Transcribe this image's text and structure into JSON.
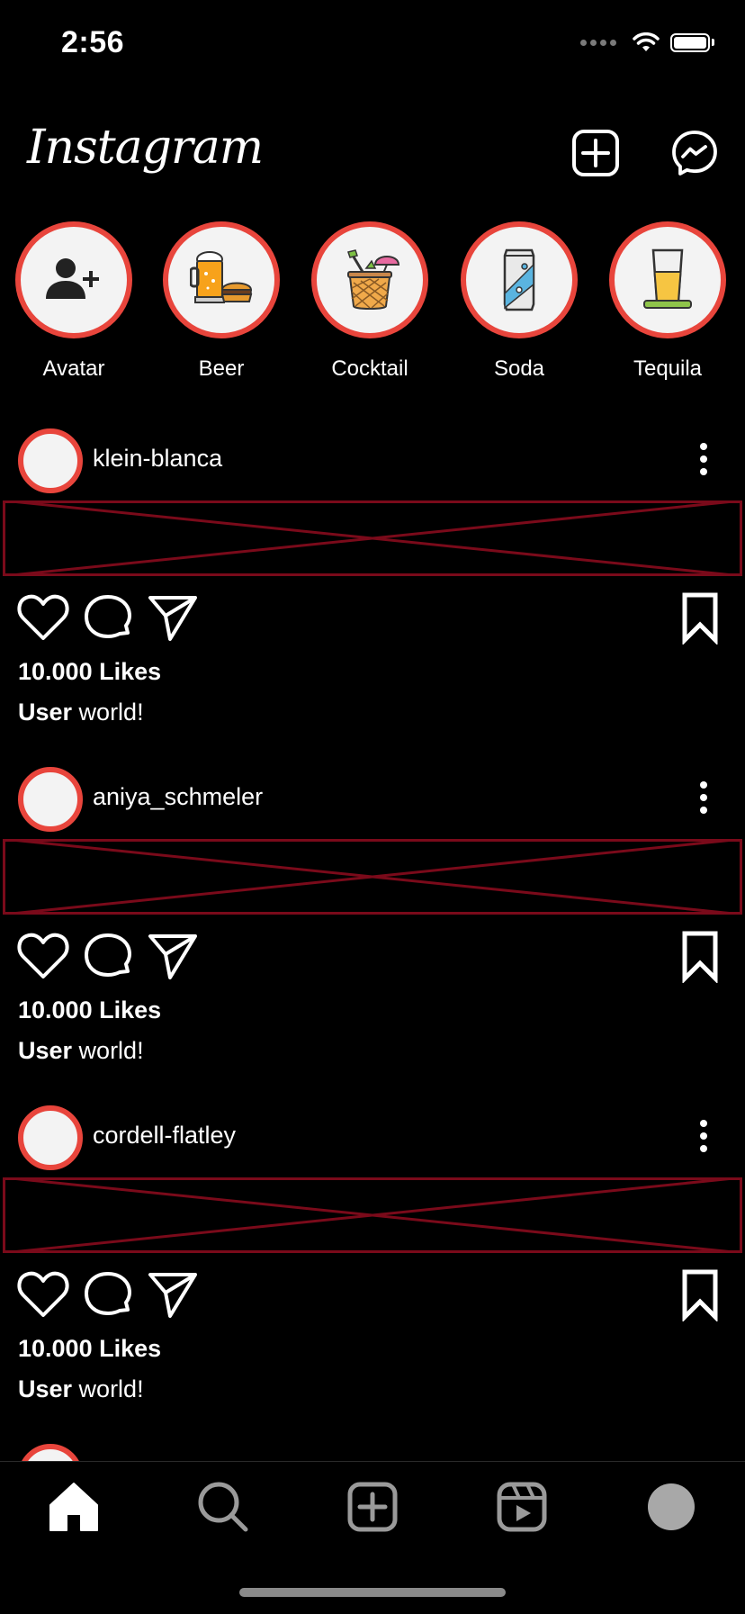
{
  "status_bar": {
    "time": "2:56"
  },
  "header": {
    "logo_text": "Instagram"
  },
  "stories": [
    {
      "label": "Avatar",
      "icon": "add-person-icon"
    },
    {
      "label": "Beer",
      "icon": "beer-mug-burger-icon"
    },
    {
      "label": "Cocktail",
      "icon": "pineapple-cocktail-icon"
    },
    {
      "label": "Soda",
      "icon": "soda-can-icon"
    },
    {
      "label": "Tequila",
      "icon": "tequila-glass-icon"
    }
  ],
  "posts": [
    {
      "username": "klein-blanca",
      "likes": "10.000 Likes",
      "caption_user": "User",
      "caption_text": " world!"
    },
    {
      "username": "aniya_schmeler",
      "likes": "10.000 Likes",
      "caption_user": "User",
      "caption_text": " world!"
    },
    {
      "username": "cordell-flatley",
      "likes": "10.000 Likes",
      "caption_user": "User",
      "caption_text": " world!"
    }
  ],
  "tabs": [
    {
      "name": "home",
      "icon": "home-icon",
      "active": true
    },
    {
      "name": "search",
      "icon": "search-icon",
      "active": false
    },
    {
      "name": "create",
      "icon": "add-square-icon",
      "active": false
    },
    {
      "name": "reels",
      "icon": "reels-icon",
      "active": false
    },
    {
      "name": "profile",
      "icon": "profile-avatar-icon",
      "active": false
    }
  ],
  "colors": {
    "background": "#000000",
    "story_ring": "#e8453c",
    "broken_image": "#7a0a1a",
    "text": "#ffffff",
    "inactive_icon": "#9a9a9a"
  }
}
